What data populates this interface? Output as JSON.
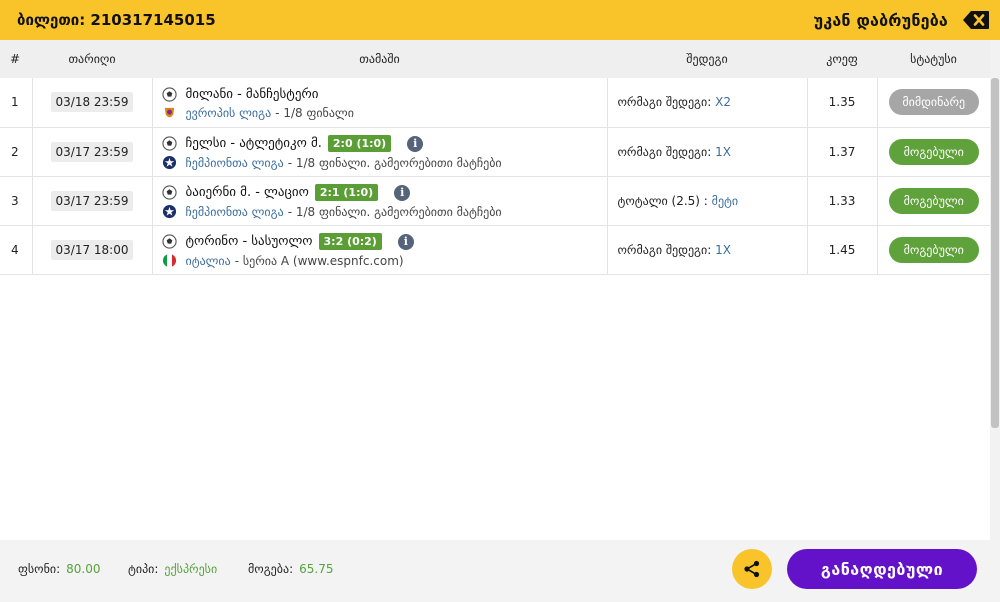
{
  "header": {
    "ticket_label": "ბილეთი: 210317145015",
    "back_label": "უკან დაბრუნება",
    "back_icon": "backspace-close-icon"
  },
  "table": {
    "columns": [
      "#",
      "თარიღი",
      "თამაში",
      "შედეგი",
      "კოეფ",
      "სტატუსი"
    ],
    "rows": [
      {
        "num": "1",
        "date": "03/18 23:59",
        "teams": "მილანი - მანჩესტერი",
        "score": "",
        "league": "ევროპის ლიგა",
        "round": "- 1/8 ფინალი",
        "market": "ორმაგი შედეგი:",
        "pick": "X2",
        "odds": "1.35",
        "status": "მიმდინარე",
        "status_type": "pending",
        "league_icon": "europa-league-icon"
      },
      {
        "num": "2",
        "date": "03/17 23:59",
        "teams": "ჩელსი - ატლეტიკო მ.",
        "score": "2:0 (1:0)",
        "league": "ჩემპიონთა ლიგა",
        "round": "- 1/8 ფინალი. გამეორებითი მატჩები",
        "market": "ორმაგი შედეგი:",
        "pick": "1X",
        "odds": "1.37",
        "status": "მოგებული",
        "status_type": "won",
        "league_icon": "champions-league-icon"
      },
      {
        "num": "3",
        "date": "03/17 23:59",
        "teams": "ბაიერნი მ. - ლაციო",
        "score": "2:1 (1:0)",
        "league": "ჩემპიონთა ლიგა",
        "round": "- 1/8 ფინალი. გამეორებითი მატჩები",
        "market": "ტოტალი (2.5) :",
        "pick": "მეტი",
        "odds": "1.33",
        "status": "მოგებული",
        "status_type": "won",
        "league_icon": "champions-league-icon"
      },
      {
        "num": "4",
        "date": "03/17 18:00",
        "teams": "ტორინო - სასუოლო",
        "score": "3:2 (0:2)",
        "league": "იტალია",
        "round": "- სერია A (www.espnfc.com)",
        "market": "ორმაგი შედეგი:",
        "pick": "1X",
        "odds": "1.45",
        "status": "მოგებული",
        "status_type": "won",
        "league_icon": "italy-flag-icon"
      }
    ]
  },
  "footer": {
    "stake_label": "ფსონი:",
    "stake_value": "80.00",
    "type_label": "ტიპი:",
    "type_value": "ექსპრესი",
    "win_label": "მოგება:",
    "win_value": "65.75",
    "placed_label": "განაღდებული"
  },
  "colors": {
    "topbar": "#f8c42a",
    "won": "#5fa13a",
    "pending": "#a6a6a6",
    "score": "#5a9e35",
    "link": "#3b6d9e",
    "placed_button": "#6412c9"
  }
}
